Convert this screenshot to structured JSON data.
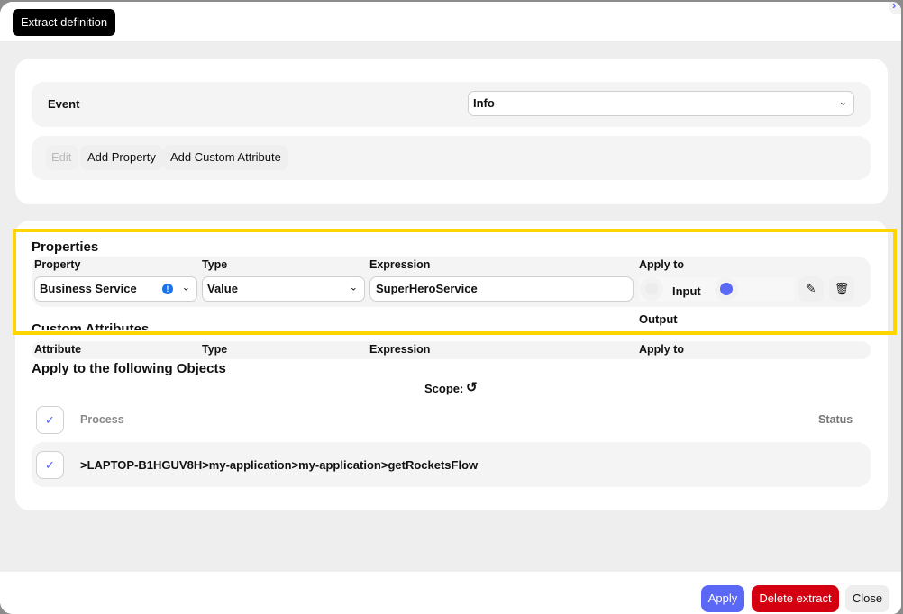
{
  "header": {
    "title": "Extract definition",
    "close_glyph": "›"
  },
  "event": {
    "label": "Event",
    "selected": "Info"
  },
  "toolbar": {
    "edit_label": "Edit",
    "add_property_label": "Add Property",
    "add_custom_attribute_label": "Add Custom Attribute"
  },
  "properties": {
    "title": "Properties",
    "columns": [
      "Property",
      "Type",
      "Expression",
      "Apply to"
    ],
    "rows": [
      {
        "property": "Business Service",
        "info_badge": "!",
        "type": "Value",
        "expression": "SuperHeroService",
        "apply_to_options": [
          "Input",
          "Output"
        ],
        "apply_to_selected": "Output"
      }
    ]
  },
  "custom_attributes": {
    "title": "Custom Attributes",
    "columns": [
      "Attribute",
      "Type",
      "Expression",
      "Apply to"
    ]
  },
  "objects": {
    "title": "Apply to the following Objects",
    "scope_label": "Scope:",
    "columns": [
      "Process",
      "Status"
    ],
    "rows": [
      {
        "process": ">LAPTOP-B1HGUV8H>my-application>my-application>getRocketsFlow",
        "status": "",
        "checked": true
      }
    ]
  },
  "footer": {
    "apply_label": "Apply",
    "delete_label": "Delete extract",
    "close_label": "Close"
  },
  "colors": {
    "accent": "#5b67f5",
    "danger": "#d40012",
    "highlight": "#ffd500"
  }
}
